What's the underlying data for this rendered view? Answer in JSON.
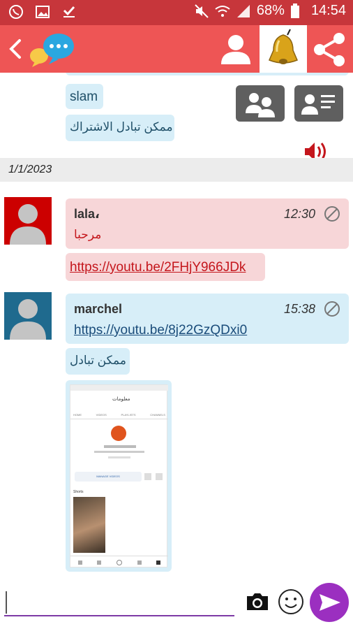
{
  "status_bar": {
    "battery": "68%",
    "time": "14:54"
  },
  "toolbar": {
    "back_icon": "chevron-left-icon",
    "logo_icon": "chat-bubbles-icon",
    "profile_icon": "person-icon",
    "bell_icon": "bell-icon",
    "share_icon": "share-icon"
  },
  "top_messages": {
    "msg1": "slam",
    "msg2": "ممكن تبادل الاشتراك"
  },
  "date_separator": "1/1/2023",
  "messages": [
    {
      "name": "lala،",
      "time": "12:30",
      "text": "مرحبا",
      "link": "https://youtu.be/2FHjY966JDk"
    },
    {
      "name": "marchel",
      "time": "15:38",
      "link": "https://youtu.be/8j22GzQDxi0",
      "text": "ممكن تبادل"
    }
  ],
  "screenshot_thumb": {
    "channel_title": "معلومات",
    "tab_labels": [
      "HOME",
      "VIDEOS",
      "PLAYLISTS",
      "CHANNELS"
    ],
    "manage_videos_label": "MANAGE VIDEOS",
    "shorts_label": "Shorts"
  },
  "colors": {
    "status_bar": "#c7363b",
    "toolbar": "#ee5555",
    "bubble_blue": "#d7eef8",
    "bubble_pink": "#f7d6d8",
    "send_purple": "#9b2fc0"
  }
}
